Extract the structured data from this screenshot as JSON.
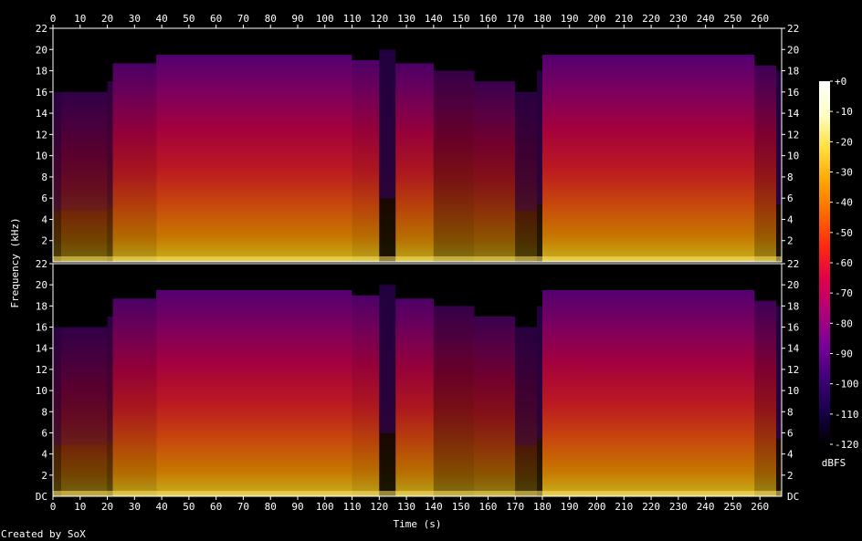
{
  "chart_data": {
    "type": "heatmap",
    "title": "",
    "xlabel": "Time (s)",
    "ylabel": "Frequency (kHz)",
    "xlim": [
      0,
      268
    ],
    "ylim": [
      0,
      22
    ],
    "x_ticks": [
      0,
      10,
      20,
      30,
      40,
      50,
      60,
      70,
      80,
      90,
      100,
      110,
      120,
      130,
      140,
      150,
      160,
      170,
      180,
      190,
      200,
      210,
      220,
      230,
      240,
      250,
      260
    ],
    "y_ticks": [
      2,
      4,
      6,
      8,
      10,
      12,
      14,
      16,
      18,
      20,
      22
    ],
    "y_bottom_label_top_channel": "22",
    "y_bottom_label_bottom_channel": "DC",
    "channels": 2,
    "colorbar": {
      "label": "dBFS",
      "ticks": [
        "+0",
        "-10",
        "-20",
        "-30",
        "-40",
        "-50",
        "-60",
        "-70",
        "-80",
        "-90",
        "-100",
        "-110",
        "-120"
      ],
      "range": [
        -120,
        0
      ]
    },
    "colormap": [
      "#000000",
      "#18004a",
      "#40007a",
      "#7a0098",
      "#b0007a",
      "#e0004a",
      "#ff2a10",
      "#ff6a00",
      "#ffa800",
      "#ffe040",
      "#ffffc8",
      "#ffffff"
    ],
    "segments": [
      {
        "t0": 0,
        "t1": 3,
        "level": 0.3,
        "cutoff": 16
      },
      {
        "t0": 3,
        "t1": 20,
        "level": 0.45,
        "cutoff": 16
      },
      {
        "t0": 20,
        "t1": 22,
        "level": 0.35,
        "cutoff": 17
      },
      {
        "t0": 22,
        "t1": 38,
        "level": 0.7,
        "cutoff": 18.7
      },
      {
        "t0": 38,
        "t1": 110,
        "level": 0.78,
        "cutoff": 19.5
      },
      {
        "t0": 110,
        "t1": 120,
        "level": 0.72,
        "cutoff": 19
      },
      {
        "t0": 120,
        "t1": 126,
        "level": 0.1,
        "cutoff": 20
      },
      {
        "t0": 126,
        "t1": 140,
        "level": 0.72,
        "cutoff": 18.7
      },
      {
        "t0": 140,
        "t1": 155,
        "level": 0.5,
        "cutoff": 18
      },
      {
        "t0": 155,
        "t1": 170,
        "level": 0.55,
        "cutoff": 17
      },
      {
        "t0": 170,
        "t1": 178,
        "level": 0.3,
        "cutoff": 16
      },
      {
        "t0": 178,
        "t1": 180,
        "level": 0.15,
        "cutoff": 18
      },
      {
        "t0": 180,
        "t1": 258,
        "level": 0.78,
        "cutoff": 19.5
      },
      {
        "t0": 258,
        "t1": 266,
        "level": 0.6,
        "cutoff": 18.5
      },
      {
        "t0": 266,
        "t1": 268,
        "level": 0.1,
        "cutoff": 18
      }
    ]
  },
  "footer": {
    "credit": "Created by SoX"
  }
}
